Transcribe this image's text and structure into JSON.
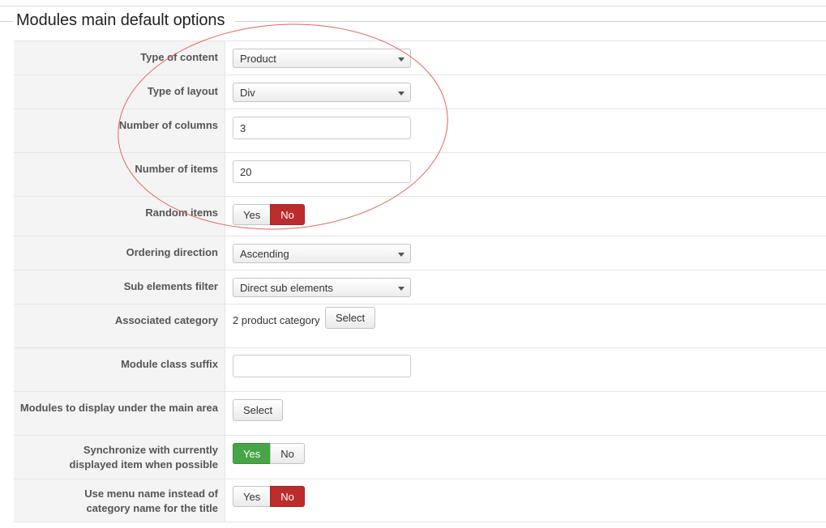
{
  "fieldset": {
    "legend": "Modules main default options"
  },
  "fields": {
    "type_of_content": {
      "label": "Type of content",
      "value": "Product"
    },
    "type_of_layout": {
      "label": "Type of layout",
      "value": "Div"
    },
    "number_of_columns": {
      "label": "Number of columns",
      "value": "3"
    },
    "number_of_items": {
      "label": "Number of items",
      "value": "20"
    },
    "random_items": {
      "label": "Random items",
      "yes": "Yes",
      "no": "No",
      "selected": "No"
    },
    "ordering_direction": {
      "label": "Ordering direction",
      "value": "Ascending"
    },
    "sub_elements_filter": {
      "label": "Sub elements filter",
      "value": "Direct sub elements"
    },
    "associated_category": {
      "label": "Associated category",
      "text": "2 product category",
      "button": "Select"
    },
    "module_class_suffix": {
      "label": "Module class suffix",
      "value": ""
    },
    "modules_under_main": {
      "label": "Modules to display under the main area",
      "button": "Select"
    },
    "synchronize": {
      "label_line1": "Synchronize with currently",
      "label_line2": "displayed item when possible",
      "yes": "Yes",
      "no": "No",
      "selected": "Yes"
    },
    "use_menu_name": {
      "label_line1": "Use menu name instead of",
      "label_line2": "category name for the title",
      "yes": "Yes",
      "no": "No",
      "selected": "No"
    }
  },
  "colors": {
    "active_no": "#bd2c2c",
    "active_yes": "#46a546",
    "annotation_ellipse": "#e0665a"
  }
}
